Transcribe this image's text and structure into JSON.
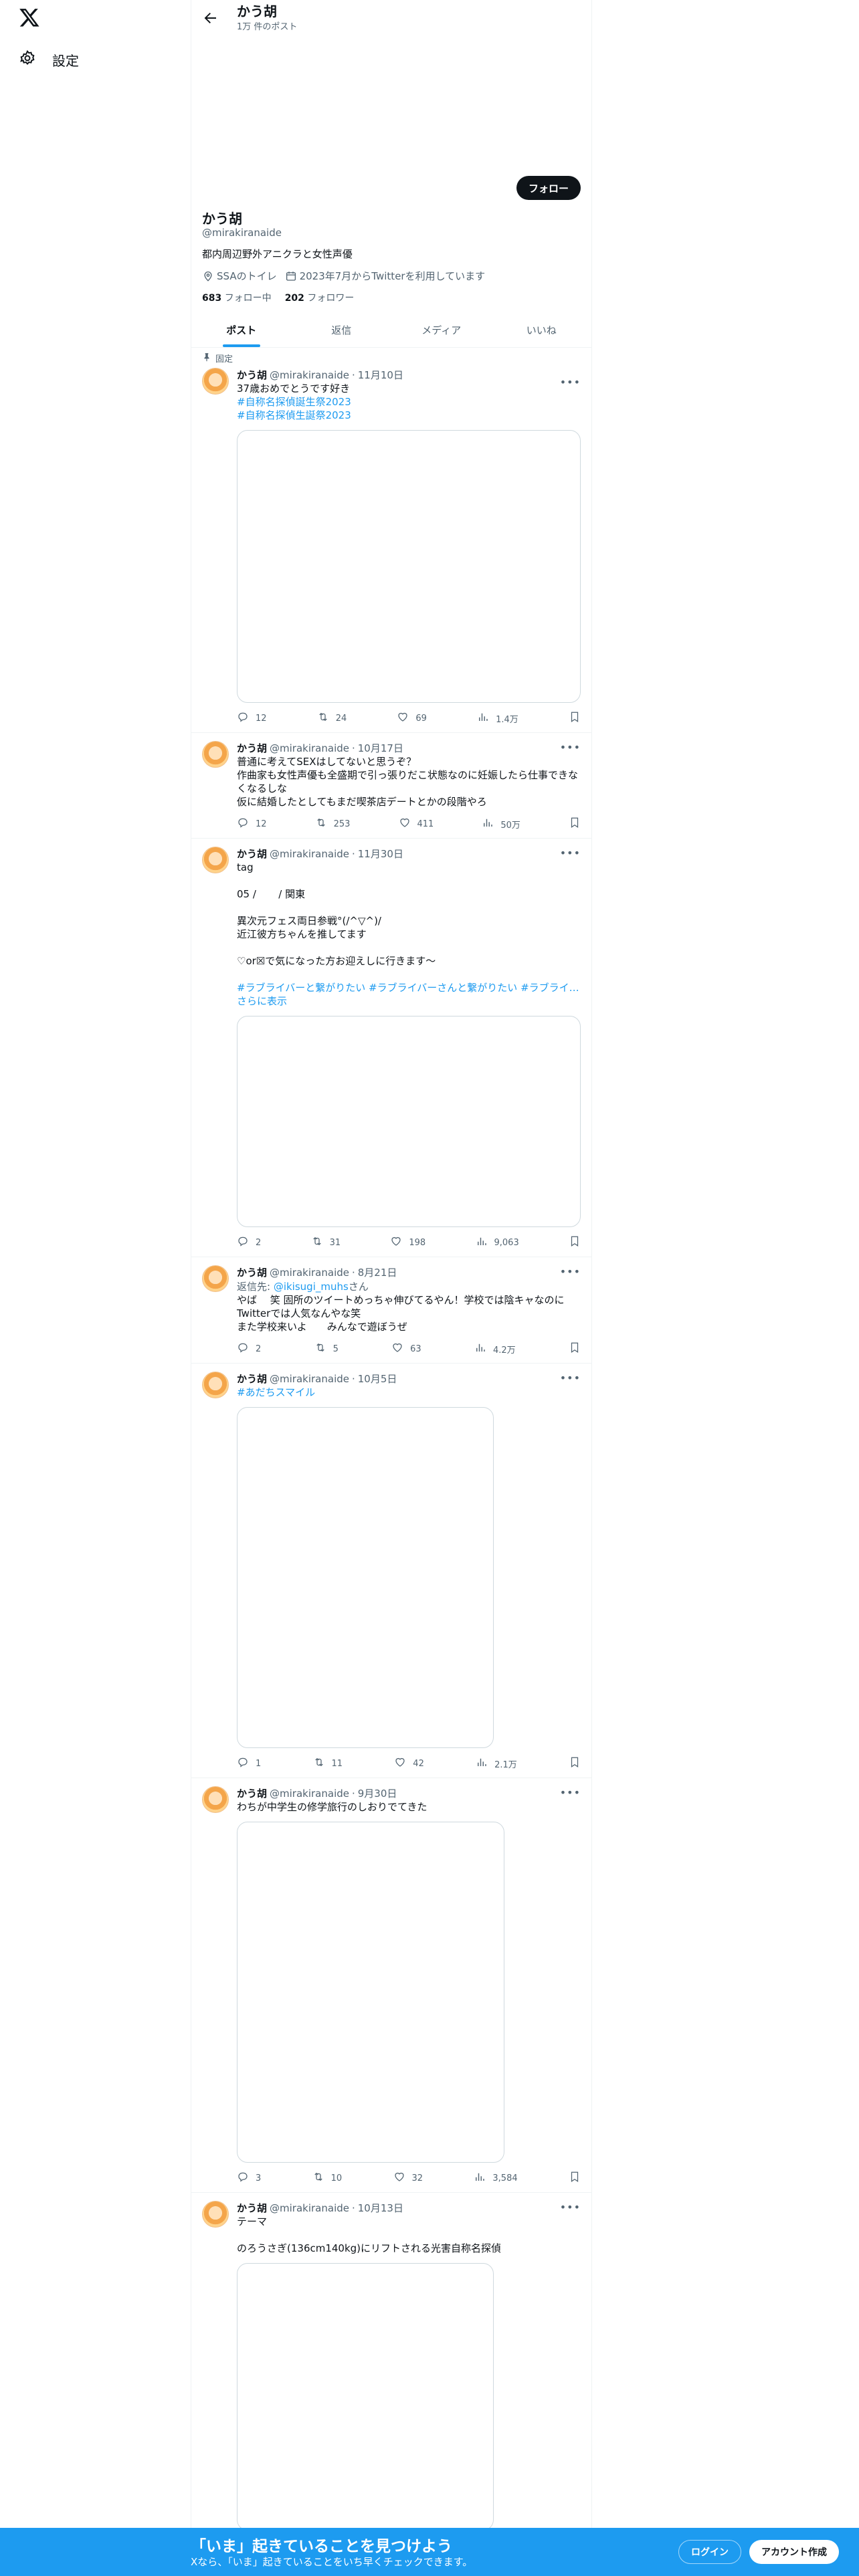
{
  "nav": {
    "settings_label": "設定"
  },
  "topbar": {
    "name": "かう胡",
    "posts_count": "1万 件のポスト"
  },
  "profile": {
    "follow_label": "フォロー",
    "name": "かう胡",
    "handle": "@mirakiranaide",
    "bio": "都内周辺野外アニクラと女性声優",
    "location": "SSAのトイレ",
    "joined": "2023年7月からTwitterを利用しています",
    "following_count": "683",
    "following_label": "フォロー中",
    "followers_count": "202",
    "followers_label": "フォロワー"
  },
  "tabs": [
    "ポスト",
    "返信",
    "メディア",
    "いいね"
  ],
  "pinned_label": "固定",
  "tweets": [
    {
      "name": "かう胡",
      "handle": "@mirakiranaide",
      "date": "11月10日",
      "text": "37歳おめでとうです好き",
      "tags": [
        "#自称名探偵誕生祭2023",
        "#自称名探偵生誕祭2023"
      ],
      "reply": "12",
      "retweet": "24",
      "like": "69",
      "views": "1.4万"
    },
    {
      "name": "かう胡",
      "handle": "@mirakiranaide",
      "date": "10月17日",
      "text": "普通に考えてSEXはしてないと思うぞ？\n作曲家も女性声優も全盛期で引っ張りだこ状態なのに妊娠したら仕事できなくなるしな\n仮に結婚したとしてもまだ喫茶店デートとかの段階やろ",
      "reply": "12",
      "retweet": "253",
      "like": "411",
      "views": "50万"
    },
    {
      "name": "かう胡",
      "handle": "@mirakiranaide",
      "date": "11月30日",
      "text": "tag\n\n05 /       / 関東\n\n異次元フェス両日参戦°(/^▽^)/\n近江彼方ちゃんを推してます\n\n♡or☒で気になった方お迎えしに行きます〜",
      "tags_line": "#ラブライバーと繋がりたい #ラブライバーさんと繋がりたい #ラブライブ...",
      "show_more": "さらに表示",
      "reply": "2",
      "retweet": "31",
      "like": "198",
      "views": "9,063"
    },
    {
      "name": "かう胡",
      "handle": "@mirakiranaide",
      "date": "8月21日",
      "reply_prefix": "返信先: ",
      "reply_to": "@ikisugi_muhs",
      "reply_suffix": "さん",
      "text": "やば　 笑 固所のツイートめっちゃ伸びてるやん！学校では陰キャなのにTwitterでは人気なんやな笑\nまた学校来いよ　　みんなで遊ぼうぜ",
      "reply": "2",
      "retweet": "5",
      "like": "63",
      "views": "4.2万"
    },
    {
      "name": "かう胡",
      "handle": "@mirakiranaide",
      "date": "10月5日",
      "tag_only": "#あだちスマイル",
      "reply": "1",
      "retweet": "11",
      "like": "42",
      "views": "2.1万"
    },
    {
      "name": "かう胡",
      "handle": "@mirakiranaide",
      "date": "9月30日",
      "text": "わちが中学生の修学旅行のしおりでてきた",
      "reply": "3",
      "retweet": "10",
      "like": "32",
      "views": "3,584"
    },
    {
      "name": "かう胡",
      "handle": "@mirakiranaide",
      "date": "10月13日",
      "text": "テーマ\n\nのろうさぎ(136cm140kg)にリフトされる光害自称名探偵"
    }
  ],
  "bottombar": {
    "title": "「いま」起きていることを見つけよう",
    "subtitle": "Xなら、「いま」起きていることをいち早くチェックできます。",
    "login": "ログイン",
    "signup": "アカウント作成"
  },
  "colors": {
    "accent": "#1d9bf0",
    "text": "#0f1419",
    "muted": "#536471"
  }
}
